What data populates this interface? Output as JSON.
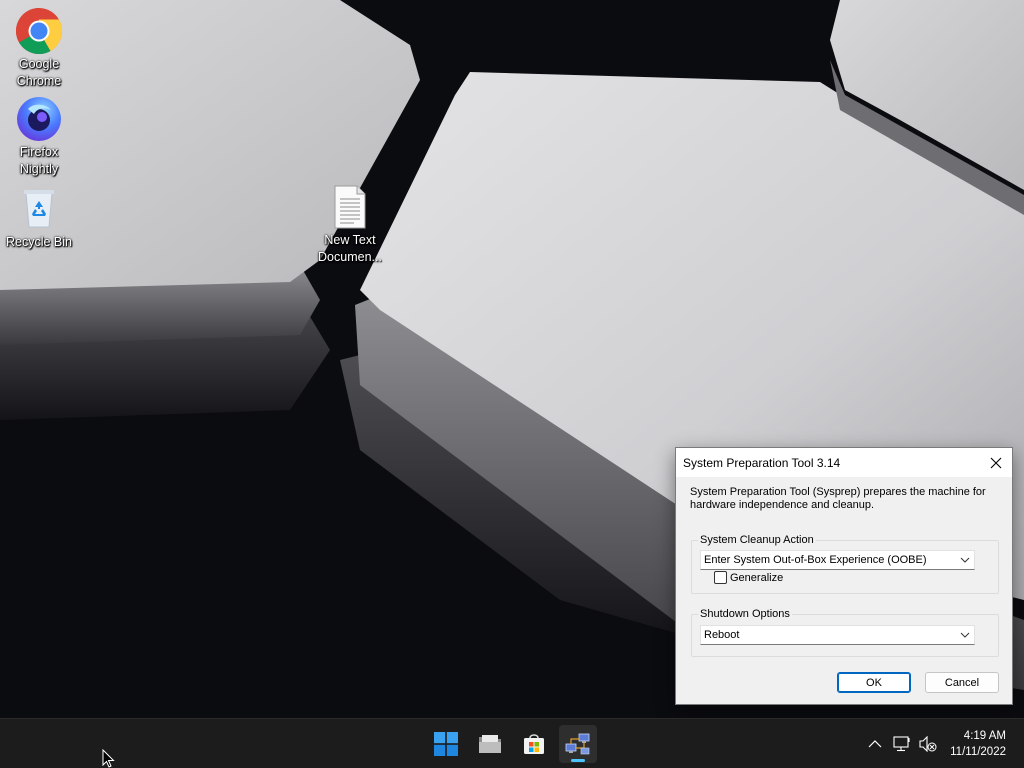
{
  "desktop": {
    "icons": [
      {
        "label": "Google\nChrome",
        "icon": "chrome-icon"
      },
      {
        "label": "Firefox\nNightly",
        "icon": "firefox-nightly-icon"
      },
      {
        "label": "Recycle Bin",
        "icon": "recycle-bin-icon"
      },
      {
        "label": "New Text\nDocumen...",
        "icon": "text-document-icon"
      }
    ]
  },
  "dialog": {
    "title": "System Preparation Tool 3.14",
    "description": "System Preparation Tool (Sysprep) prepares the machine for hardware independence and cleanup.",
    "cleanup_group_label": "System Cleanup Action",
    "cleanup_action_value": "Enter System Out-of-Box Experience (OOBE)",
    "generalize_label": "Generalize",
    "generalize_checked": false,
    "shutdown_group_label": "Shutdown Options",
    "shutdown_value": "Reboot",
    "ok_label": "OK",
    "cancel_label": "Cancel"
  },
  "taskbar": {
    "items": [
      {
        "name": "start",
        "icon": "windows-start-icon"
      },
      {
        "name": "file-explorer",
        "icon": "folder-icon"
      },
      {
        "name": "microsoft-store",
        "icon": "store-icon"
      },
      {
        "name": "sysprep",
        "icon": "network-computers-icon",
        "active": true
      }
    ],
    "tray": [
      "chevron-up-icon",
      "network-icon",
      "speaker-muted-icon"
    ],
    "time": "4:19 AM",
    "date": "11/11/2022"
  },
  "colors": {
    "accent": "#0067c0",
    "taskbar_bg": "#1c1c1c",
    "dialog_bg": "#f0f0f0",
    "active_indicator": "#4cc2ff"
  }
}
